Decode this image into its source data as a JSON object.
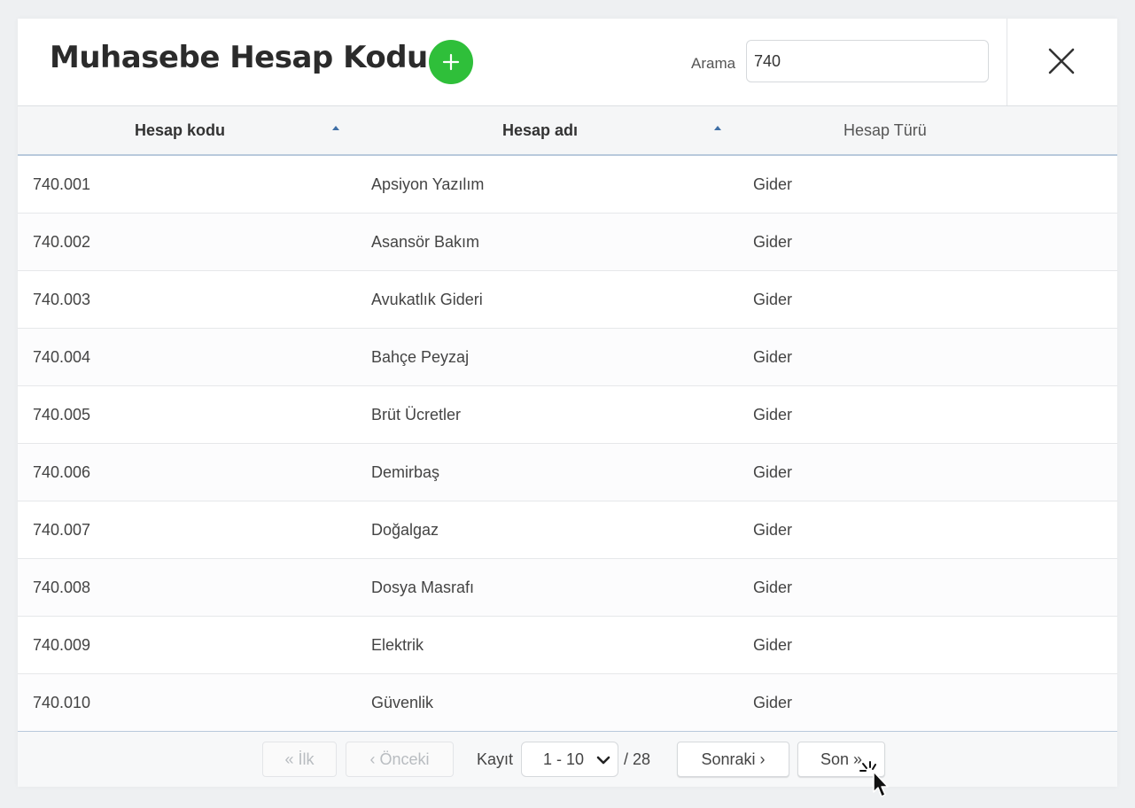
{
  "dialog": {
    "title": "Muhasebe Hesap Kodu",
    "search_label": "Arama",
    "search_value": "740"
  },
  "table": {
    "columns": [
      {
        "label": "Hesap kodu",
        "sorted": "asc"
      },
      {
        "label": "Hesap adı",
        "sorted": "asc"
      },
      {
        "label": "Hesap Türü"
      }
    ],
    "rows": [
      {
        "code": "740.001",
        "name": "Apsiyon Yazılım",
        "type": "Gider"
      },
      {
        "code": "740.002",
        "name": "Asansör Bakım",
        "type": "Gider"
      },
      {
        "code": "740.003",
        "name": "Avukatlık Gideri",
        "type": "Gider"
      },
      {
        "code": "740.004",
        "name": "Bahçe Peyzaj",
        "type": "Gider"
      },
      {
        "code": "740.005",
        "name": "Brüt Ücretler",
        "type": "Gider"
      },
      {
        "code": "740.006",
        "name": "Demirbaş",
        "type": "Gider"
      },
      {
        "code": "740.007",
        "name": "Doğalgaz",
        "type": "Gider"
      },
      {
        "code": "740.008",
        "name": "Dosya Masrafı",
        "type": "Gider"
      },
      {
        "code": "740.009",
        "name": "Elektrik",
        "type": "Gider"
      },
      {
        "code": "740.010",
        "name": "Güvenlik",
        "type": "Gider"
      }
    ]
  },
  "pagination": {
    "first": "« İlk",
    "prev": "‹ Önceki",
    "record_label": "Kayıt",
    "range": "1 - 10",
    "total": "/ 28",
    "next": "Sonraki ›",
    "last": "Son »"
  },
  "colors": {
    "accent_green": "#2fbf3a",
    "sort_arrow": "#3f6fa6",
    "header_border": "#b9c9dc"
  },
  "icons": [
    "plus-icon",
    "close-icon",
    "sort-asc-icon",
    "chevron-down-icon",
    "hand-cursor-icon"
  ]
}
